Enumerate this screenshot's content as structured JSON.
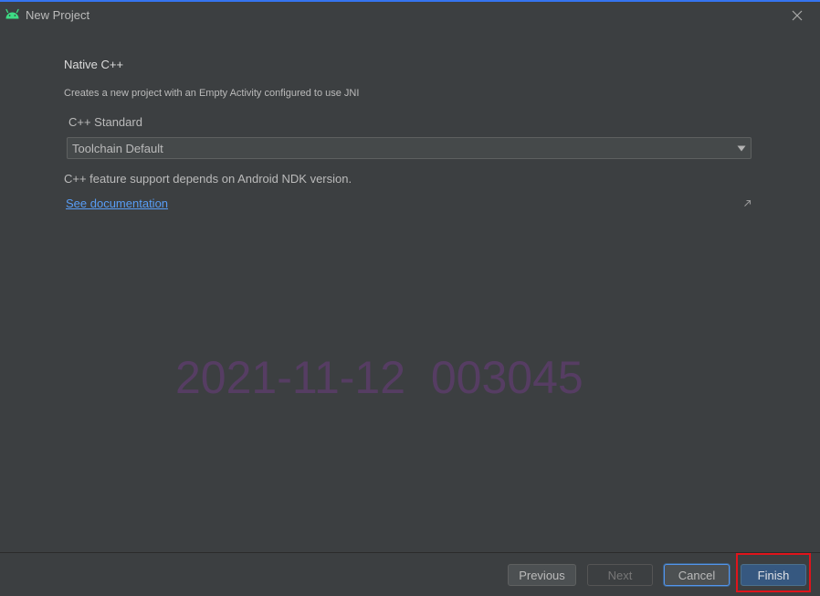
{
  "window": {
    "title": "New Project",
    "icon": "android-icon",
    "close_icon": "close-icon",
    "accent_color": "#3574f0"
  },
  "content": {
    "heading": "Native C++",
    "description": "Creates a new project with an Empty Activity configured to use JNI",
    "cpp_standard": {
      "label": "C++ Standard",
      "selected_value": "Toolchain Default"
    },
    "support_note": "C++ feature support depends on Android NDK version.",
    "documentation_link": "See documentation",
    "link_color": "#589df6",
    "watermark": "2021-11-12  003045"
  },
  "footer": {
    "previous_label": "Previous",
    "next_label": "Next",
    "cancel_label": "Cancel",
    "finish_label": "Finish",
    "primary_color": "#365880",
    "highlight_color": "#e0141b"
  }
}
